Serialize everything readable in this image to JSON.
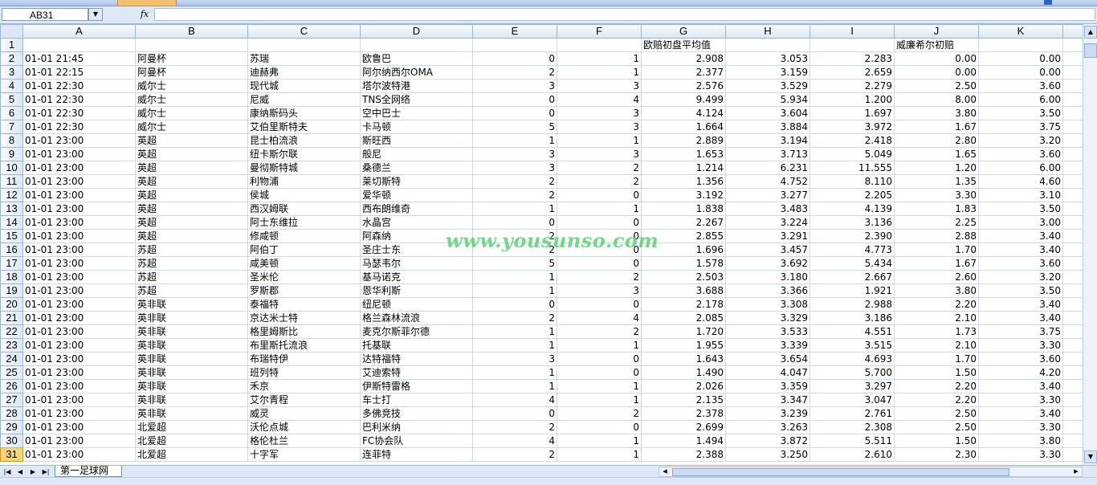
{
  "namebox": {
    "value": "AB31"
  },
  "formula": {
    "fx_label": "fx",
    "value": ""
  },
  "columns": [
    "A",
    "B",
    "C",
    "D",
    "E",
    "F",
    "G",
    "H",
    "I",
    "J",
    "K"
  ],
  "header_row": {
    "row": "1",
    "G": "欧赔初盘平均值",
    "J": "威廉希尔初赔"
  },
  "rows": [
    {
      "n": "2",
      "A": "01-01 21:45",
      "B": "阿曼杯",
      "C": "苏瑞",
      "D": "欧鲁巴",
      "E": "0",
      "F": "1",
      "G": "2.908",
      "H": "3.053",
      "I": "2.283",
      "J": "0.00",
      "K": "0.00"
    },
    {
      "n": "3",
      "A": "01-01 22:15",
      "B": "阿曼杯",
      "C": "迪赫弗",
      "D": "阿尔纳西尔OMA",
      "E": "2",
      "F": "1",
      "G": "2.377",
      "H": "3.159",
      "I": "2.659",
      "J": "0.00",
      "K": "0.00"
    },
    {
      "n": "4",
      "A": "01-01 22:30",
      "B": "威尔士",
      "C": "现代城",
      "D": "塔尔波特港",
      "E": "3",
      "F": "3",
      "G": "2.576",
      "H": "3.529",
      "I": "2.279",
      "J": "2.50",
      "K": "3.60"
    },
    {
      "n": "5",
      "A": "01-01 22:30",
      "B": "威尔士",
      "C": "尼威",
      "D": "TNS全网络",
      "E": "0",
      "F": "4",
      "G": "9.499",
      "H": "5.934",
      "I": "1.200",
      "J": "8.00",
      "K": "6.00"
    },
    {
      "n": "6",
      "A": "01-01 22:30",
      "B": "威尔士",
      "C": "康纳斯码头",
      "D": "空中巴士",
      "E": "0",
      "F": "3",
      "G": "4.124",
      "H": "3.604",
      "I": "1.697",
      "J": "3.80",
      "K": "3.50"
    },
    {
      "n": "7",
      "A": "01-01 22:30",
      "B": "威尔士",
      "C": "艾伯里斯特夫",
      "D": "卡马顿",
      "E": "5",
      "F": "3",
      "G": "1.664",
      "H": "3.884",
      "I": "3.972",
      "J": "1.67",
      "K": "3.75"
    },
    {
      "n": "8",
      "A": "01-01 23:00",
      "B": "英超",
      "C": "昆士柏流浪",
      "D": "斯旺西",
      "E": "1",
      "F": "1",
      "G": "2.889",
      "H": "3.194",
      "I": "2.418",
      "J": "2.80",
      "K": "3.20"
    },
    {
      "n": "9",
      "A": "01-01 23:00",
      "B": "英超",
      "C": "纽卡斯尔联",
      "D": "般尼",
      "E": "3",
      "F": "3",
      "G": "1.653",
      "H": "3.713",
      "I": "5.049",
      "J": "1.65",
      "K": "3.60"
    },
    {
      "n": "10",
      "A": "01-01 23:00",
      "B": "英超",
      "C": "曼彻斯特城",
      "D": "桑德兰",
      "E": "3",
      "F": "2",
      "G": "1.214",
      "H": "6.231",
      "I": "11.555",
      "J": "1.20",
      "K": "6.00"
    },
    {
      "n": "11",
      "A": "01-01 23:00",
      "B": "英超",
      "C": "利物浦",
      "D": "莱切斯特",
      "E": "2",
      "F": "2",
      "G": "1.356",
      "H": "4.752",
      "I": "8.110",
      "J": "1.35",
      "K": "4.60"
    },
    {
      "n": "12",
      "A": "01-01 23:00",
      "B": "英超",
      "C": "侯城",
      "D": "爱华顿",
      "E": "2",
      "F": "0",
      "G": "3.192",
      "H": "3.277",
      "I": "2.205",
      "J": "3.30",
      "K": "3.10"
    },
    {
      "n": "13",
      "A": "01-01 23:00",
      "B": "英超",
      "C": "西汉姆联",
      "D": "西布朗维奇",
      "E": "1",
      "F": "1",
      "G": "1.838",
      "H": "3.483",
      "I": "4.139",
      "J": "1.83",
      "K": "3.50"
    },
    {
      "n": "14",
      "A": "01-01 23:00",
      "B": "英超",
      "C": "阿士东维拉",
      "D": "水晶宫",
      "E": "0",
      "F": "0",
      "G": "2.267",
      "H": "3.224",
      "I": "3.136",
      "J": "2.25",
      "K": "3.00"
    },
    {
      "n": "15",
      "A": "01-01 23:00",
      "B": "英超",
      "C": "修咸顿",
      "D": "阿森纳",
      "E": "2",
      "F": "0",
      "G": "2.855",
      "H": "3.291",
      "I": "2.390",
      "J": "2.88",
      "K": "3.40"
    },
    {
      "n": "16",
      "A": "01-01 23:00",
      "B": "苏超",
      "C": "阿伯丁",
      "D": "圣庄士东",
      "E": "2",
      "F": "0",
      "G": "1.696",
      "H": "3.457",
      "I": "4.773",
      "J": "1.70",
      "K": "3.40"
    },
    {
      "n": "17",
      "A": "01-01 23:00",
      "B": "苏超",
      "C": "咸美顿",
      "D": "马瑟韦尔",
      "E": "5",
      "F": "0",
      "G": "1.578",
      "H": "3.692",
      "I": "5.434",
      "J": "1.67",
      "K": "3.60"
    },
    {
      "n": "18",
      "A": "01-01 23:00",
      "B": "苏超",
      "C": "圣米伦",
      "D": "基马诺克",
      "E": "1",
      "F": "2",
      "G": "2.503",
      "H": "3.180",
      "I": "2.667",
      "J": "2.60",
      "K": "3.20"
    },
    {
      "n": "19",
      "A": "01-01 23:00",
      "B": "苏超",
      "C": "罗斯郡",
      "D": "恩华利斯",
      "E": "1",
      "F": "3",
      "G": "3.688",
      "H": "3.366",
      "I": "1.921",
      "J": "3.80",
      "K": "3.50"
    },
    {
      "n": "20",
      "A": "01-01 23:00",
      "B": "英非联",
      "C": "泰福特",
      "D": "纽尼顿",
      "E": "0",
      "F": "0",
      "G": "2.178",
      "H": "3.308",
      "I": "2.988",
      "J": "2.20",
      "K": "3.40"
    },
    {
      "n": "21",
      "A": "01-01 23:00",
      "B": "英非联",
      "C": "京达米士特",
      "D": "格兰森林流浪",
      "E": "2",
      "F": "4",
      "G": "2.085",
      "H": "3.329",
      "I": "3.186",
      "J": "2.10",
      "K": "3.40"
    },
    {
      "n": "22",
      "A": "01-01 23:00",
      "B": "英非联",
      "C": "格里姆斯比",
      "D": "麦克尔斯菲尔德",
      "E": "1",
      "F": "2",
      "G": "1.720",
      "H": "3.533",
      "I": "4.551",
      "J": "1.73",
      "K": "3.75"
    },
    {
      "n": "23",
      "A": "01-01 23:00",
      "B": "英非联",
      "C": "布里斯托流浪",
      "D": "托基联",
      "E": "1",
      "F": "1",
      "G": "1.955",
      "H": "3.339",
      "I": "3.515",
      "J": "2.10",
      "K": "3.30"
    },
    {
      "n": "24",
      "A": "01-01 23:00",
      "B": "英非联",
      "C": "布瑞特伊",
      "D": "达特福特",
      "E": "3",
      "F": "0",
      "G": "1.643",
      "H": "3.654",
      "I": "4.693",
      "J": "1.70",
      "K": "3.60"
    },
    {
      "n": "25",
      "A": "01-01 23:00",
      "B": "英非联",
      "C": "班列特",
      "D": "艾迪索特",
      "E": "1",
      "F": "0",
      "G": "1.490",
      "H": "4.047",
      "I": "5.700",
      "J": "1.50",
      "K": "4.20"
    },
    {
      "n": "26",
      "A": "01-01 23:00",
      "B": "英非联",
      "C": "禾京",
      "D": "伊斯特雷格",
      "E": "1",
      "F": "1",
      "G": "2.026",
      "H": "3.359",
      "I": "3.297",
      "J": "2.20",
      "K": "3.40"
    },
    {
      "n": "27",
      "A": "01-01 23:00",
      "B": "英非联",
      "C": "艾尔青程",
      "D": "车士打",
      "E": "4",
      "F": "1",
      "G": "2.135",
      "H": "3.347",
      "I": "3.047",
      "J": "2.20",
      "K": "3.30"
    },
    {
      "n": "28",
      "A": "01-01 23:00",
      "B": "英非联",
      "C": "威灵",
      "D": "多佛竞技",
      "E": "0",
      "F": "2",
      "G": "2.378",
      "H": "3.239",
      "I": "2.761",
      "J": "2.50",
      "K": "3.40"
    },
    {
      "n": "29",
      "A": "01-01 23:00",
      "B": "北爱超",
      "C": "沃伦点城",
      "D": "巴利米纳",
      "E": "2",
      "F": "0",
      "G": "2.699",
      "H": "3.263",
      "I": "2.308",
      "J": "2.50",
      "K": "3.30"
    },
    {
      "n": "30",
      "A": "01-01 23:00",
      "B": "北爱超",
      "C": "格伦杜兰",
      "D": "FC协会队",
      "E": "4",
      "F": "1",
      "G": "1.494",
      "H": "3.872",
      "I": "5.511",
      "J": "1.50",
      "K": "3.80"
    },
    {
      "n": "31",
      "A": "01-01 23:00",
      "B": "北爱超",
      "C": "十字军",
      "D": "连菲特",
      "E": "2",
      "F": "1",
      "G": "2.388",
      "H": "3.250",
      "I": "2.610",
      "J": "2.30",
      "K": "3.30"
    }
  ],
  "active_row": "31",
  "sheet_tabs": [
    {
      "label": "第一足球网"
    }
  ],
  "watermark": "www.yousunso.com",
  "colors": {
    "header_bg": "#dce6f4",
    "active_row_header": "#f8d57a",
    "watermark": "#5fcf77"
  }
}
